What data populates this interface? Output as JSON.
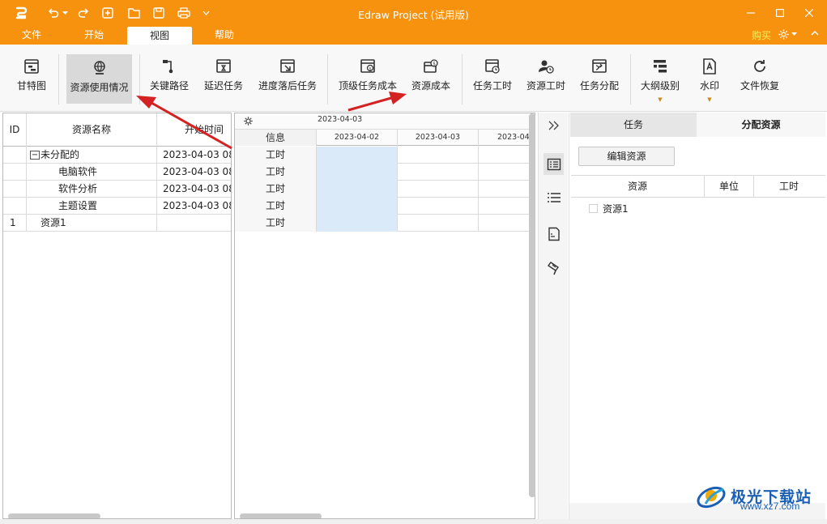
{
  "window": {
    "title": "Edraw Project  (试用版)",
    "icons": [
      "app-logo-icon",
      "undo-icon",
      "redo-icon",
      "new-icon",
      "open-folder-icon",
      "save-icon",
      "print-icon",
      "customize-icon",
      "minimize-icon",
      "maximize-icon",
      "close-icon"
    ]
  },
  "menu": {
    "tabs": [
      "文件",
      "开始",
      "视图",
      "帮助"
    ],
    "active": "视图",
    "buy": "购买"
  },
  "ribbon": {
    "buttons": [
      {
        "label": "甘特图",
        "icon": "gantt-icon"
      },
      {
        "label": "资源使用情况",
        "icon": "resource-usage-icon",
        "selected": true
      },
      {
        "label": "关键路径",
        "icon": "critical-path-icon"
      },
      {
        "label": "延迟任务",
        "icon": "delayed-task-icon"
      },
      {
        "label": "进度落后任务",
        "icon": "behind-schedule-icon"
      },
      {
        "label": "顶级任务成本",
        "icon": "top-task-cost-icon"
      },
      {
        "label": "资源成本",
        "icon": "resource-cost-icon"
      },
      {
        "label": "任务工时",
        "icon": "task-hours-icon"
      },
      {
        "label": "资源工时",
        "icon": "resource-hours-icon"
      },
      {
        "label": "任务分配",
        "icon": "task-assign-icon"
      },
      {
        "label": "大纲级别",
        "icon": "outline-level-icon"
      },
      {
        "label": "水印",
        "icon": "watermark-icon"
      },
      {
        "label": "文件恢复",
        "icon": "file-recovery-icon"
      }
    ]
  },
  "resource_table": {
    "headers": [
      "ID",
      "资源名称",
      "开始时间"
    ],
    "rows": [
      {
        "id": "",
        "name": "未分配的",
        "start": "2023-04-03 08",
        "group": true
      },
      {
        "id": "",
        "name": "电脑软件",
        "start": "2023-04-03 08"
      },
      {
        "id": "",
        "name": "软件分析",
        "start": "2023-04-03 08"
      },
      {
        "id": "",
        "name": "主题设置",
        "start": "2023-04-03 08"
      },
      {
        "id": "1",
        "name": "资源1",
        "start": ""
      }
    ],
    "expander": "−"
  },
  "usage_grid": {
    "top_date": "2023-04-03",
    "info_header": "信息",
    "dates": [
      "2023-04-02",
      "2023-04-03",
      "2023-04-0"
    ],
    "row_label": "工时",
    "row_labels": [
      "工时",
      "工时",
      "工时",
      "工时",
      "工时"
    ]
  },
  "right_panel": {
    "tabs": [
      "任务",
      "分配资源"
    ],
    "active_tab": "分配资源",
    "edit_button": "编辑资源",
    "columns": [
      "资源",
      "单位",
      "工时"
    ],
    "resources": [
      "资源1"
    ]
  },
  "watermark": {
    "text": "极光下载站",
    "url": "www.xz7.com"
  },
  "colors": {
    "title_bar": "#f7920f",
    "highlight_cell": "#dbeaf9",
    "arrow": "#d42121",
    "buy_text": "#ffef5a"
  }
}
